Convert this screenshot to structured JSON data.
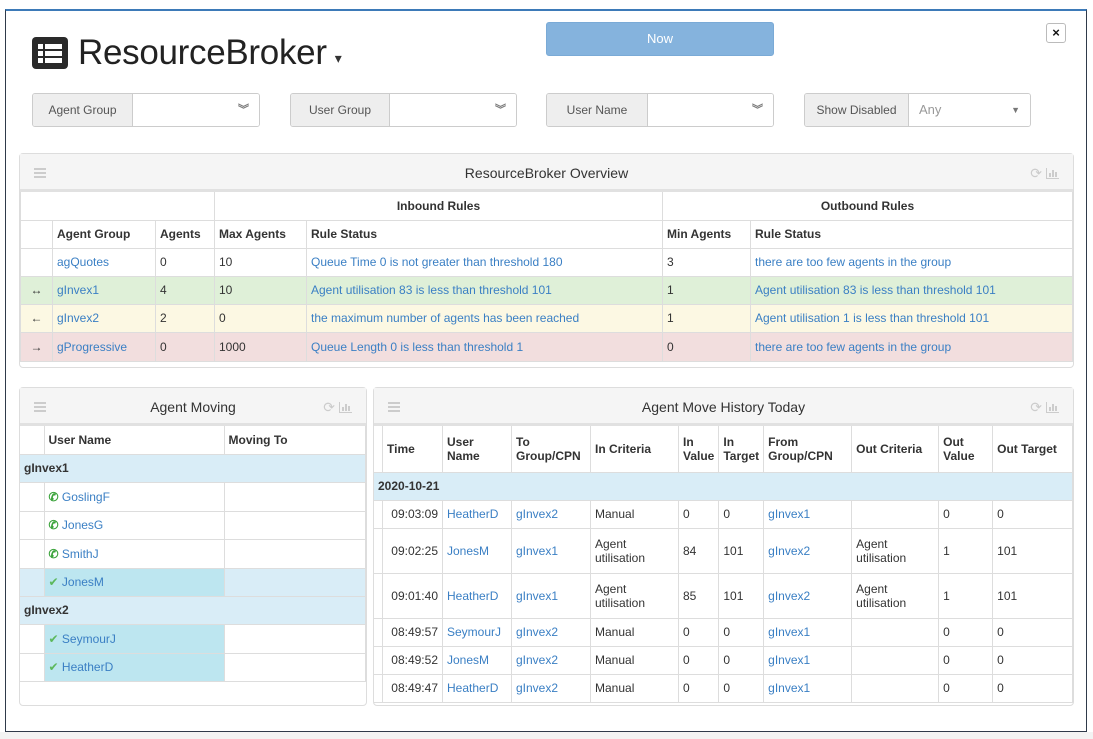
{
  "header": {
    "title": "ResourceBroker",
    "title_icon": "list-icon",
    "now_label": "Now",
    "close_label": "×"
  },
  "filters": [
    {
      "label": "Agent Group",
      "value": "",
      "icon": "double-chevron-down-icon"
    },
    {
      "label": "User Group",
      "value": "",
      "icon": "double-chevron-down-icon"
    },
    {
      "label": "User Name",
      "value": "",
      "icon": "double-chevron-down-icon"
    },
    {
      "label": "Show Disabled",
      "value": "Any",
      "icon": "caret-down-icon"
    }
  ],
  "overview": {
    "title": "ResourceBroker Overview",
    "group_headers": {
      "inbound": "Inbound Rules",
      "outbound": "Outbound Rules"
    },
    "columns": [
      "Agent Group",
      "Agents",
      "Max Agents",
      "Rule Status",
      "Min Agents",
      "Rule Status"
    ],
    "rows": [
      {
        "arrow": "",
        "group": "agQuotes",
        "agents": "0",
        "max": "10",
        "in_status": "Queue Time 0 is not greater than threshold 180",
        "min": "3",
        "out_status": "there are too few agents in the group",
        "style": ""
      },
      {
        "arrow": "↔",
        "group": "gInvex1",
        "agents": "4",
        "max": "10",
        "in_status": "Agent utilisation 83 is less than threshold 101",
        "min": "1",
        "out_status": "Agent utilisation 83 is less than threshold 101",
        "style": "green"
      },
      {
        "arrow": "←",
        "group": "gInvex2",
        "agents": "2",
        "max": "0",
        "in_status": "the maximum number of agents has been reached",
        "min": "1",
        "out_status": "Agent utilisation 1 is less than threshold 101",
        "style": "yellow"
      },
      {
        "arrow": "→",
        "group": "gProgressive",
        "agents": "0",
        "max": "1000",
        "in_status": "Queue Length 0 is less than threshold 1",
        "min": "0",
        "out_status": "there are too few agents in the group",
        "style": "red"
      }
    ]
  },
  "moving": {
    "title": "Agent Moving",
    "columns": [
      "User Name",
      "Moving To"
    ],
    "groups": [
      {
        "name": "gInvex1",
        "users": [
          {
            "name": "GoslingF",
            "icon": "phone",
            "moving_to": "",
            "highlight": false
          },
          {
            "name": "JonesG",
            "icon": "phone",
            "moving_to": "",
            "highlight": false
          },
          {
            "name": "SmithJ",
            "icon": "phone",
            "moving_to": "",
            "highlight": false
          },
          {
            "name": "JonesM",
            "icon": "check",
            "moving_to": "",
            "highlight": true
          }
        ]
      },
      {
        "name": "gInvex2",
        "users": [
          {
            "name": "SeymourJ",
            "icon": "check",
            "moving_to": "",
            "highlight": true
          },
          {
            "name": "HeatherD",
            "icon": "check",
            "moving_to": "",
            "highlight": true
          }
        ]
      }
    ]
  },
  "history": {
    "title": "Agent Move History Today",
    "columns": [
      "Time",
      "User Name",
      "To Group/CPN",
      "In Criteria",
      "In Value",
      "In Target",
      "From Group/CPN",
      "Out Criteria",
      "Out Value",
      "Out Target"
    ],
    "date": "2020-10-21",
    "rows": [
      [
        "09:03:09",
        "HeatherD",
        "gInvex2",
        "Manual",
        "0",
        "0",
        "gInvex1",
        "",
        "0",
        "0"
      ],
      [
        "09:02:25",
        "JonesM",
        "gInvex1",
        "Agent utilisation",
        "84",
        "101",
        "gInvex2",
        "Agent utilisation",
        "1",
        "101"
      ],
      [
        "09:01:40",
        "HeatherD",
        "gInvex1",
        "Agent utilisation",
        "85",
        "101",
        "gInvex2",
        "Agent utilisation",
        "1",
        "101"
      ],
      [
        "08:49:57",
        "SeymourJ",
        "gInvex2",
        "Manual",
        "0",
        "0",
        "gInvex1",
        "",
        "0",
        "0"
      ],
      [
        "08:49:52",
        "JonesM",
        "gInvex2",
        "Manual",
        "0",
        "0",
        "gInvex1",
        "",
        "0",
        "0"
      ],
      [
        "08:49:47",
        "HeatherD",
        "gInvex2",
        "Manual",
        "0",
        "0",
        "gInvex1",
        "",
        "0",
        "0"
      ]
    ]
  }
}
